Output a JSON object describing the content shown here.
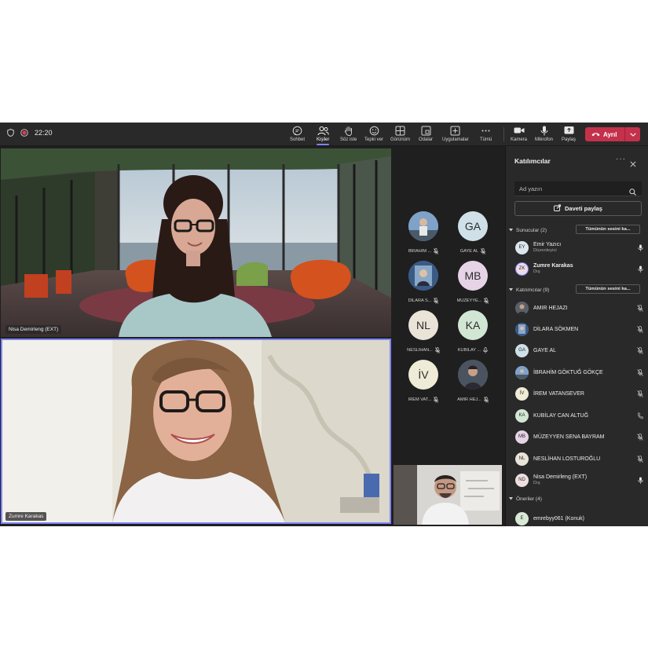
{
  "topbar": {
    "time": "22:20",
    "buttons": [
      {
        "label": "Sohbet",
        "icon": "chat-icon"
      },
      {
        "label": "Kişiler",
        "icon": "people-icon"
      },
      {
        "label": "Söz iste",
        "icon": "raise-hand-icon"
      },
      {
        "label": "Tepki ver",
        "icon": "react-icon"
      },
      {
        "label": "Görünüm",
        "icon": "view-icon"
      },
      {
        "label": "Odalar",
        "icon": "rooms-icon"
      },
      {
        "label": "Uygulamalar",
        "icon": "apps-icon"
      },
      {
        "label": "Tümü",
        "icon": "more-icon"
      },
      {
        "label": "Kamera",
        "icon": "camera-icon"
      },
      {
        "label": "Mikrofon",
        "icon": "microphone-icon"
      },
      {
        "label": "Paylaş",
        "icon": "share-icon"
      }
    ],
    "leave_label": "Ayrıl",
    "accent": "#c4314b"
  },
  "videos": {
    "main": {
      "name": "Nisa Demirleng (EXT)"
    },
    "second": {
      "name": "Zumre Karakas"
    }
  },
  "avatar_grid": [
    {
      "name": "İBRAHİM ...",
      "initials": "",
      "photo": true,
      "bg": "#6b8fb8"
    },
    {
      "name": "GAYE AL",
      "initials": "GA",
      "bg": "#cfe0e8"
    },
    {
      "name": "DİLARA S...",
      "initials": "",
      "photo": true,
      "bg": "#4a6d9a"
    },
    {
      "name": "MÜZEYYE...",
      "initials": "MB",
      "bg": "#e7d3e6"
    },
    {
      "name": "NESLİHAN...",
      "initials": "NL",
      "bg": "#e9e3d8"
    },
    {
      "name": "KUBİLAY ...",
      "initials": "KA",
      "bg": "#d2e6d4"
    },
    {
      "name": "İREM VAT...",
      "initials": "İV",
      "bg": "#eeebd6"
    },
    {
      "name": "AMIR HEJ...",
      "initials": "",
      "photo": true,
      "bg": "#5a6470"
    }
  ],
  "panel": {
    "title": "Katılımcılar",
    "search_placeholder": "Ad yazın",
    "invite_label": "Daveti paylaş",
    "presenters_header": "Sunucular (2)",
    "attendees_header": "Katılımcılar (9)",
    "suggestions_header": "Öneriler (4)",
    "mute_all_label": "Tümünün sesini ka...",
    "presenters": [
      {
        "initials": "EY",
        "name": "Emir Yazıcı",
        "sub": "Düzenleyici",
        "bg": "#dbe6ee",
        "bold": false
      },
      {
        "initials": "ZK",
        "name": "Zumre Karakas",
        "sub": "Dış",
        "bg": "#eddbe6",
        "bold": true
      }
    ],
    "attendees": [
      {
        "initials": "",
        "name": "AMIR HEJAZI",
        "photo": true,
        "bg": "#6a6f78"
      },
      {
        "initials": "",
        "name": "DİLARA SÖKMEN",
        "photo": true,
        "bg": "#4a6d9a"
      },
      {
        "initials": "GA",
        "name": "GAYE AL",
        "bg": "#cfe0e8"
      },
      {
        "initials": "",
        "name": "İBRAHİM GÖKTUĞ GÖKÇE",
        "photo": true,
        "bg": "#6b8fb8"
      },
      {
        "initials": "İV",
        "name": "İREM VATANSEVER",
        "bg": "#eeebd6"
      },
      {
        "initials": "KA",
        "name": "KUBİLAY CAN ALTUĞ",
        "bg": "#d2e6d4"
      },
      {
        "initials": "MB",
        "name": "MÜZEYYEN SENA BAYRAM",
        "bg": "#e7d3e6"
      },
      {
        "initials": "NL",
        "name": "NESLİHAN LOSTUROĞLU",
        "bg": "#e9e3d8"
      },
      {
        "initials": "ND",
        "name": "Nisa Demirleng (EXT)",
        "sub": "Dış",
        "bg": "#eddfe0"
      }
    ],
    "suggestions": [
      {
        "initials": "E",
        "name": "emrebyy061 (Konuk)",
        "bg": "#d8ead6"
      }
    ]
  }
}
